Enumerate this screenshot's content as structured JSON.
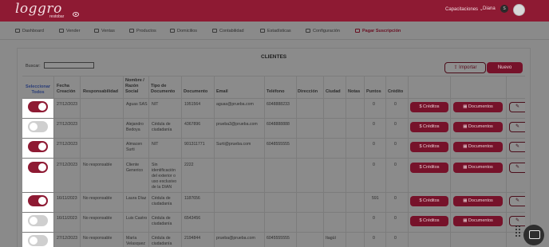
{
  "header": {
    "logo_text": "loggro",
    "logo_sub": "restobar",
    "capacitaciones": "Capacitaciones ⌄",
    "user_name": "Diana",
    "user_initial": "S"
  },
  "nav": [
    {
      "label": "Dashboard",
      "icon": "dashboard-icon"
    },
    {
      "label": "Vender",
      "icon": "cart-icon"
    },
    {
      "label": "Ventas",
      "icon": "tag-icon"
    },
    {
      "label": "Productos",
      "icon": "box-icon"
    },
    {
      "label": "Domicilios",
      "icon": "motorcycle-icon"
    },
    {
      "label": "Contabilidad",
      "icon": "ledger-icon"
    },
    {
      "label": "Estadísticas",
      "icon": "trend-icon"
    },
    {
      "label": "Configuración",
      "icon": "gear-icon"
    },
    {
      "label": "Pagar Suscripción",
      "icon": "card-icon"
    }
  ],
  "page": {
    "title": "CLIENTES",
    "search_label": "Buscar:",
    "search_value": "",
    "import_label": "⇪ Importar",
    "new_label": "Nuevo"
  },
  "table": {
    "headers": {
      "select": "Seleccionar Todos",
      "fecha": "Fecha Creación",
      "resp": "Responsabilidad",
      "nombre": "Nombre / Razón Social",
      "tipo": "Tipo de Documento",
      "doc": "Documento",
      "email": "Email",
      "tel": "Teléfono",
      "dir": "Dirección",
      "ciudad": "Ciudad",
      "notas": "Notas",
      "puntos": "Puntos",
      "credito": "Crédito"
    },
    "creditos_label": "$ Créditos",
    "documentos_label": "▦ Documentos",
    "edit_label": "✎",
    "rows": [
      {
        "on": true,
        "fecha": "27/12/2023",
        "resp": "",
        "nombre": "Aguas SAS",
        "tipo": "NIT",
        "doc": "1951564",
        "email": "aguas@prueba.com",
        "tel": "6048888233",
        "ciudad": "",
        "puntos": "0",
        "credito": "0"
      },
      {
        "on": false,
        "fecha": "27/12/2023",
        "resp": "",
        "nombre": "Alejandro Bedoya",
        "tipo": "Cédula de ciudadanía",
        "doc": "4367896",
        "email": "prueba3@prueba.com",
        "tel": "6048888888",
        "ciudad": "",
        "puntos": "0",
        "credito": "0"
      },
      {
        "on": true,
        "fecha": "27/12/2023",
        "resp": "",
        "nombre": "Almacen Surti",
        "tipo": "NIT",
        "doc": "901311771",
        "email": "Surti@prueba.com",
        "tel": "6048555555",
        "ciudad": "",
        "puntos": "0",
        "credito": "0"
      },
      {
        "on": true,
        "fecha": "27/12/2023",
        "resp": "No responsable",
        "nombre": "Cliente Generico",
        "tipo": "Sin identificación del exterior o uso exclusivo de la DIAN",
        "doc": "2222",
        "email": "",
        "tel": "",
        "ciudad": "",
        "puntos": "0",
        "credito": "0"
      },
      {
        "on": true,
        "fecha": "16/11/2023",
        "resp": "No responsable",
        "nombre": "Laura Díaz",
        "tipo": "Cédula de ciudadanía",
        "doc": "1187656",
        "email": "",
        "tel": "",
        "ciudad": "",
        "puntos": "591",
        "credito": "0"
      },
      {
        "on": false,
        "fecha": "16/11/2023",
        "resp": "No responsable",
        "nombre": "Luis Castro",
        "tipo": "Cédula de ciudadanía",
        "doc": "6543456",
        "email": "",
        "tel": "",
        "ciudad": "",
        "puntos": "0",
        "credito": "0"
      },
      {
        "on": false,
        "fecha": "27/12/2023",
        "resp": "No responsable",
        "nombre": "María Velasquez",
        "tipo": "Cédula de ciudadanía",
        "doc": "2194844",
        "email": "prueba@prueba.com",
        "tel": "6045555555",
        "ciudad": "Itagüí",
        "puntos": "0",
        "credito": "0"
      }
    ]
  }
}
